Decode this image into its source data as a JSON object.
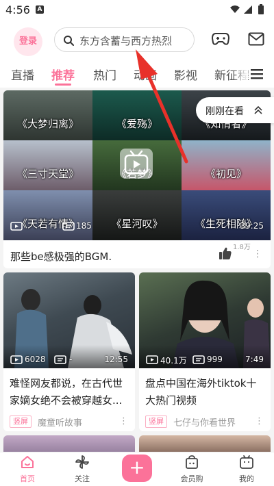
{
  "status_bar": {
    "time": "4:56",
    "notification": "A"
  },
  "header": {
    "login": "登录",
    "search_placeholder": "东方含蓄与西方热烈"
  },
  "tabs": [
    "直播",
    "推荐",
    "热门",
    "动画",
    "影视",
    "新征程"
  ],
  "active_tab": "推荐",
  "recently_watched": "刚刚在看",
  "big_card": {
    "captions": [
      "《大梦归离》",
      "《爱殇》",
      "《知情者》",
      "《三寸天堂》",
      "《若梦》",
      "《初见》",
      "《天若有情》",
      "《星河叹》",
      "《生死相随》"
    ],
    "play_count": "",
    "danmaku_count": "185",
    "duration": "39:25",
    "title": "那些be感极强的BGM.",
    "likes": "1.8万"
  },
  "cards": [
    {
      "play_count": "6028",
      "danmaku_count": "-",
      "duration": "12:55",
      "title": "难怪网友都说，在古代世家嫡女绝不会被穿越女...",
      "tag": "竖屏",
      "author": "魔童听故事"
    },
    {
      "play_count": "40.1万",
      "danmaku_count": "999",
      "duration": "7:49",
      "title": "盘点中国在海外tiktok十大热门视频",
      "tag": "竖屏",
      "author": "七仔与你看世界"
    }
  ],
  "bottom_nav": {
    "home": "首页",
    "follow": "关注",
    "plus": "+",
    "mall": "会员购",
    "mine": "我的"
  },
  "colors": {
    "accent": "#fb7299",
    "annotation_arrow": "#e8312a"
  }
}
